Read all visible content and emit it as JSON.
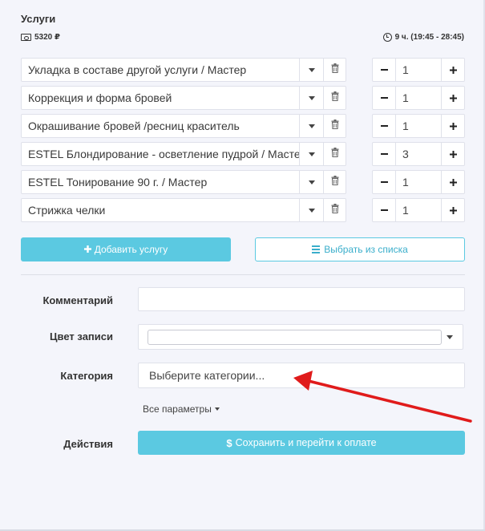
{
  "services": {
    "title": "Услуги",
    "total_price": "5320 ₽",
    "duration": "9 ч. (19:45 - 28:45)",
    "items": [
      {
        "name": "Укладка в составе другой услуги / Мастер",
        "quantity": "1"
      },
      {
        "name": "Коррекция и форма бровей",
        "quantity": "1"
      },
      {
        "name": "Окрашивание  бровей /ресниц краситель",
        "quantity": "1"
      },
      {
        "name": "ESTEL Блондирование - осветление пудрой / Мастер",
        "quantity": "3"
      },
      {
        "name": "ESTEL Тонирование 90 г. / Мастер",
        "quantity": "1"
      },
      {
        "name": "Стрижка челки",
        "quantity": "1"
      }
    ],
    "add_label": "Добавить услугу",
    "choose_label": "Выбрать из списка"
  },
  "form": {
    "comment_label": "Комментарий",
    "comment_value": "",
    "color_label": "Цвет записи",
    "category_label": "Категория",
    "category_placeholder": "Выберите категории...",
    "all_params_label": "Все параметры",
    "actions_label": "Действия",
    "save_label": "Сохранить и перейти к оплате"
  },
  "colors": {
    "accent": "#5bc9e1",
    "background": "#f4f5fb",
    "annotation_arrow": "#e01b1b"
  },
  "icons": {
    "price": "cash-icon",
    "duration": "clock-icon",
    "dropdown": "chevron-down-icon",
    "delete": "trash-icon",
    "add": "plus-icon",
    "list": "list-icon",
    "save": "dollar-icon"
  }
}
